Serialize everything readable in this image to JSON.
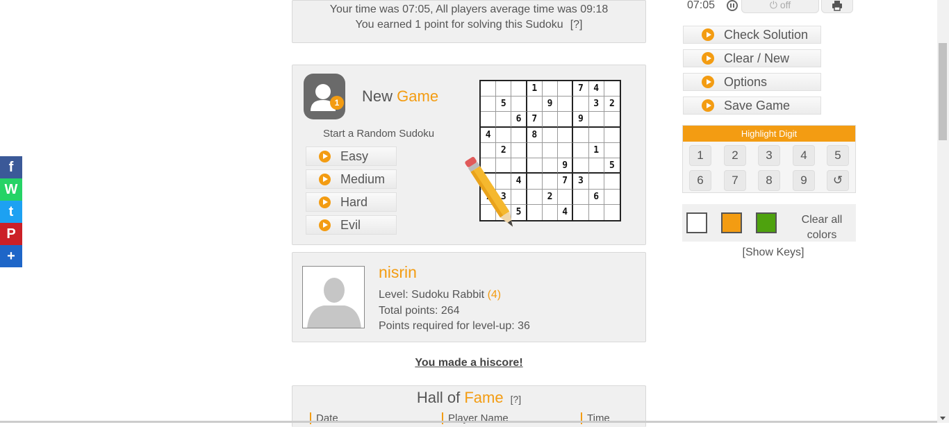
{
  "social": {
    "facebook": "f",
    "whatsapp": "W",
    "twitter": "t",
    "pinterest": "P",
    "share": "+"
  },
  "result": {
    "line1": "Your time was 07:05, All players average time was 09:18",
    "line2": "You earned 1 point for solving this Sudoku",
    "help": "[?]"
  },
  "new_game": {
    "title_prefix": "New",
    "title_accent": "Game",
    "avatar_badge": "1",
    "subtitle": "Start a Random Sudoku",
    "levels": [
      "Easy",
      "Medium",
      "Hard",
      "Evil"
    ]
  },
  "sudoku": {
    "rows": [
      [
        "",
        "",
        "",
        "1",
        "",
        "",
        "7",
        "4",
        ""
      ],
      [
        "",
        "5",
        "",
        "",
        "9",
        "",
        "",
        "3",
        "2"
      ],
      [
        "",
        "",
        "6",
        "7",
        "",
        "",
        "9",
        "",
        ""
      ],
      [
        "4",
        "",
        "",
        "8",
        "",
        "",
        "",
        "",
        ""
      ],
      [
        "",
        "2",
        "",
        "",
        "",
        "",
        "",
        "1",
        ""
      ],
      [
        "",
        "",
        "",
        "",
        "",
        "9",
        "",
        "",
        "5"
      ],
      [
        "",
        "",
        "4",
        "",
        "",
        "7",
        "3",
        "",
        ""
      ],
      [
        "7",
        "3",
        "",
        "",
        "2",
        "",
        "",
        "6",
        ""
      ],
      [
        "",
        "",
        "5",
        "",
        "",
        "4",
        "",
        "",
        ""
      ]
    ]
  },
  "profile": {
    "name": "nisrin",
    "level_label": "Level: Sudoku Rabbit",
    "level_num": "(4)",
    "total_points": "Total points: 264",
    "points_required": "Points required for level-up: 36"
  },
  "hiscore": "You made a hiscore!",
  "hall_of_fame": {
    "title_prefix": "Hall of",
    "title_accent": "Fame",
    "help": "[?]",
    "columns": [
      "Date",
      "Player Name",
      "Time"
    ]
  },
  "timer": {
    "time": "07:05",
    "off_label": "off"
  },
  "actions": [
    "Check Solution",
    "Clear / New",
    "Options",
    "Save Game"
  ],
  "highlight": {
    "title": "Highlight Digit",
    "digits": [
      "1",
      "2",
      "3",
      "4",
      "5",
      "6",
      "7",
      "8",
      "9"
    ],
    "undo_icon": "↺"
  },
  "colors": {
    "swatches": [
      "#ffffff",
      "#f39c12",
      "#4ea20e"
    ],
    "clear_label": "Clear all colors"
  },
  "show_keys": "[Show Keys]"
}
